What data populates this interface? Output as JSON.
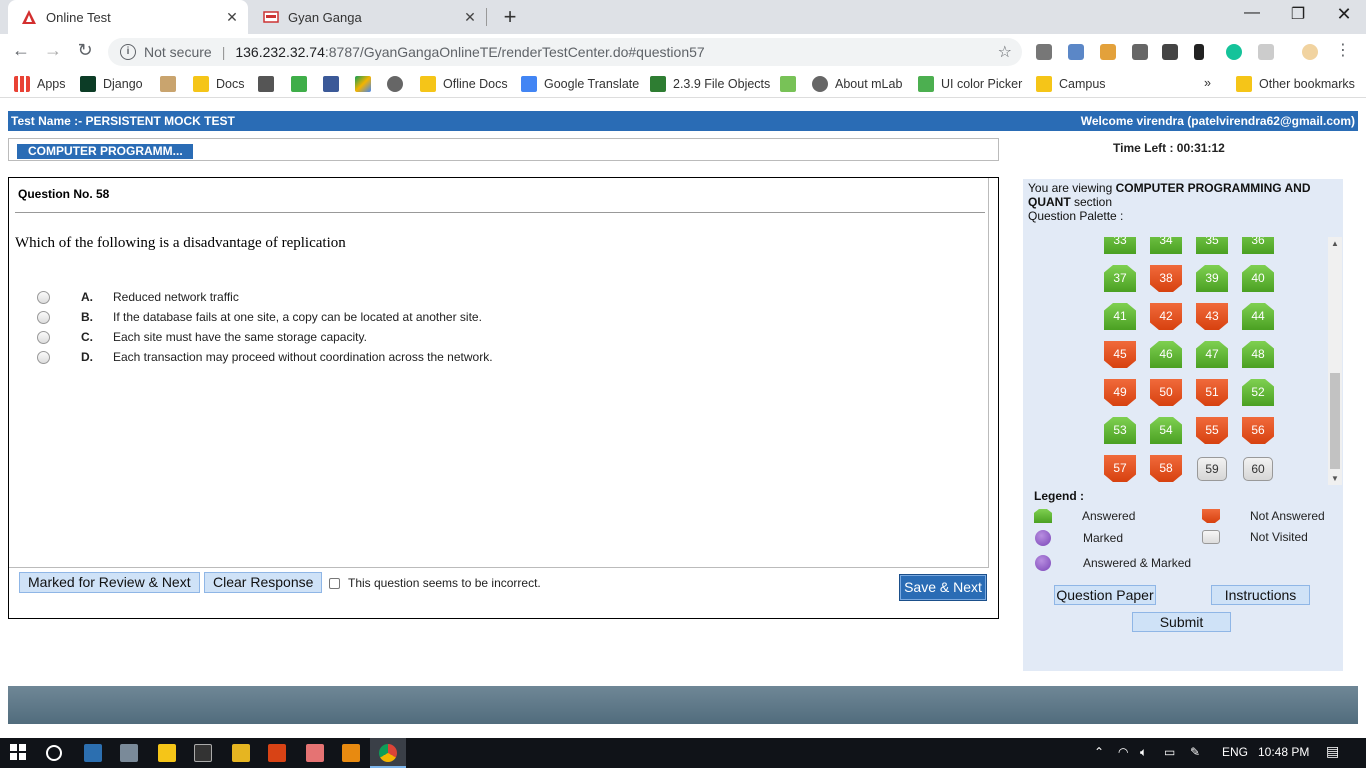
{
  "browser": {
    "tabs": [
      {
        "title": "Online Test",
        "active": true
      },
      {
        "title": "Gyan Ganga",
        "active": false
      }
    ],
    "omnibox": {
      "security_label": "Not secure",
      "host": "136.232.32.74",
      "path": ":8787/GyanGangaOnlineTE/renderTestCenter.do#question57"
    },
    "bookmarks": [
      {
        "label": "Apps",
        "icon": "apps-grid-icon"
      },
      {
        "label": "Django",
        "icon": "django-icon"
      },
      {
        "label": "",
        "icon": "image-icon"
      },
      {
        "label": "Docs",
        "icon": "folder-icon"
      },
      {
        "label": "",
        "icon": "wm-icon"
      },
      {
        "label": "",
        "icon": "px-icon"
      },
      {
        "label": "",
        "icon": "facebook-icon"
      },
      {
        "label": "",
        "icon": "drive-icon"
      },
      {
        "label": "",
        "icon": "globe-icon"
      },
      {
        "label": "Ofline Docs",
        "icon": "folder-icon"
      },
      {
        "label": "Google Translate",
        "icon": "translate-icon"
      },
      {
        "label": "2.3.9 File Objects",
        "icon": "python-icon"
      },
      {
        "label": "",
        "icon": "android-icon"
      },
      {
        "label": "About mLab",
        "icon": "globe-icon"
      },
      {
        "label": "UI color Picker",
        "icon": "color-picker-icon"
      },
      {
        "label": "Campus",
        "icon": "folder-icon"
      }
    ],
    "bookmarks_more": "»",
    "other_bookmarks": "Other bookmarks"
  },
  "test": {
    "name": "Test Name :- PERSISTENT MOCK TEST",
    "welcome": "Welcome virendra (patelvirendra62@gmail.com)",
    "section_tab": "COMPUTER PROGRAMM...",
    "time_left": "Time Left : 00:31:12"
  },
  "question": {
    "number_label": "Question No. 58",
    "text": "Which of the following is a disadvantage of replication",
    "options": [
      {
        "letter": "A.",
        "text": "Reduced network traffic"
      },
      {
        "letter": "B.",
        "text": "If the database fails at one site, a copy can be located at another site."
      },
      {
        "letter": "C.",
        "text": "Each site must have the same storage capacity."
      },
      {
        "letter": "D.",
        "text": "Each transaction may proceed without coordination across the network."
      }
    ]
  },
  "actions": {
    "mark_review": "Marked for  Review & Next",
    "clear_response": "Clear Response",
    "incorrect_label": "This question seems to be incorrect.",
    "save_next": "Save & Next"
  },
  "panel": {
    "viewing_prefix": "You are viewing ",
    "section_name": "COMPUTER PROGRAMMING AND QUANT",
    "viewing_suffix": " section",
    "palette_label": "Question Palette :",
    "palette": [
      {
        "n": "33",
        "s": "ans"
      },
      {
        "n": "34",
        "s": "ans"
      },
      {
        "n": "35",
        "s": "ans"
      },
      {
        "n": "36",
        "s": "ans"
      },
      {
        "n": "37",
        "s": "ans"
      },
      {
        "n": "38",
        "s": "not"
      },
      {
        "n": "39",
        "s": "ans"
      },
      {
        "n": "40",
        "s": "ans"
      },
      {
        "n": "41",
        "s": "ans"
      },
      {
        "n": "42",
        "s": "not"
      },
      {
        "n": "43",
        "s": "not"
      },
      {
        "n": "44",
        "s": "ans"
      },
      {
        "n": "45",
        "s": "not"
      },
      {
        "n": "46",
        "s": "ans"
      },
      {
        "n": "47",
        "s": "ans"
      },
      {
        "n": "48",
        "s": "ans"
      },
      {
        "n": "49",
        "s": "not"
      },
      {
        "n": "50",
        "s": "not"
      },
      {
        "n": "51",
        "s": "not"
      },
      {
        "n": "52",
        "s": "ans"
      },
      {
        "n": "53",
        "s": "ans"
      },
      {
        "n": "54",
        "s": "ans"
      },
      {
        "n": "55",
        "s": "not"
      },
      {
        "n": "56",
        "s": "not"
      },
      {
        "n": "57",
        "s": "not"
      },
      {
        "n": "58",
        "s": "not"
      },
      {
        "n": "59",
        "s": "unv"
      },
      {
        "n": "60",
        "s": "unv"
      }
    ],
    "legend_title": "Legend :",
    "legend": {
      "answered": "Answered",
      "not_answered": "Not Answered",
      "marked": "Marked",
      "not_visited": "Not Visited",
      "answered_marked": "Answered & Marked"
    },
    "question_paper": "Question Paper",
    "instructions": "Instructions",
    "submit": "Submit"
  },
  "taskbar": {
    "language": "ENG",
    "time": "10:48 PM"
  },
  "colors": {
    "header_blue": "#2a6cb5",
    "answered_green": "#5cb531",
    "not_answered_red": "#e0501f",
    "panel_bg": "#e2eaf6"
  }
}
